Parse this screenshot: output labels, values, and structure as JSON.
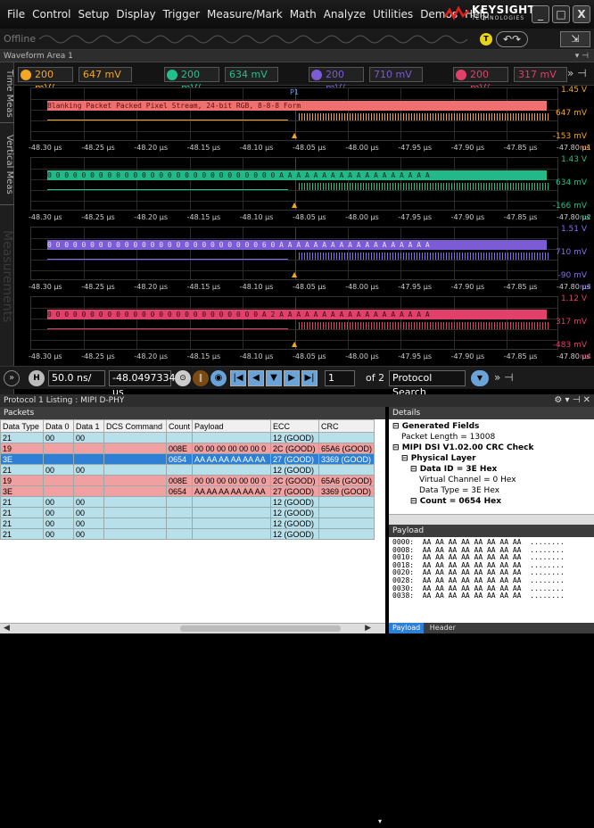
{
  "menu": [
    "File",
    "Control",
    "Setup",
    "Display",
    "Trigger",
    "Measure/Mark",
    "Math",
    "Analyze",
    "Utilities",
    "Demos",
    "Help"
  ],
  "brand": {
    "name": "KEYSIGHT",
    "sub": "TECHNOLOGIES"
  },
  "window_buttons": {
    "minimize": "_",
    "maximize": "□",
    "close": "X"
  },
  "status": {
    "offline": "Offline"
  },
  "waveform_area": {
    "title": "Waveform Area 1"
  },
  "side_tabs": [
    "Time Meas",
    "Vertical Meas",
    "Measurements"
  ],
  "channel_chips": [
    {
      "id": "m3",
      "label": "200 mV/",
      "offset": "647 mV",
      "color": "#f5a623"
    },
    {
      "id": "m2",
      "label": "200 mV/",
      "offset": "634 mV",
      "color": "#22c08a"
    },
    {
      "id": "m3b",
      "label": "200 mV/",
      "offset": "710 mV",
      "color": "#7b5bd6"
    },
    {
      "id": "m4",
      "label": "200 mV/",
      "offset": "317 mV",
      "color": "#e0406a"
    }
  ],
  "panels": [
    {
      "top": "1.45 V",
      "mid": "647 mV",
      "bot": "-153 mV",
      "ch": "m1",
      "bus_color": "#f07070",
      "bus_text": "Blanking Packet                         Packed Pixel Stream, 24-bit RGB, 8-8-8 Form",
      "sig_color": "#f5a623",
      "marker": "P1"
    },
    {
      "top": "1.43 V",
      "mid": "634 mV",
      "bot": "-166 mV",
      "ch": "m2",
      "bus_color": "#22b888",
      "bus_text": "0 0 0 0 0 0 0 0 0 0 0 0 0 0 0 0 0 0 0 0 0 0 0 0 0 0 0 A A A A A A A A A A A A A A A A A A",
      "sig_color": "#22c08a",
      "marker": ""
    },
    {
      "top": "1.51 V",
      "mid": "710 mV",
      "bot": "-90 mV",
      "ch": "m3",
      "bus_color": "#7b5bd6",
      "bus_text": "0 0 0 0 0 0 0 0 0 0 0 0 0 0 0 0 0 0 0 0 0 0 0 0 0 6 0 A A A A A A A A A A A A A A A A A A",
      "sig_color": "#8a6cf0",
      "marker": ""
    },
    {
      "top": "1.12 V",
      "mid": "317 mV",
      "bot": "-483 mV",
      "ch": "m4",
      "bus_color": "#e0406a",
      "bus_text": "0 0 0 0 0 0 0 0 0 0 0 0 0 0 0 0 0 0 0 0 0 0 0 0 0 A 2 A A A A A A A A A A A A A A A A A A",
      "sig_color": "#e0406a",
      "marker": ""
    }
  ],
  "axis_ticks": [
    "-48.30 µs",
    "-48.25 µs",
    "-48.20 µs",
    "-48.15 µs",
    "-48.10 µs",
    "-48.05 µs",
    "-48.00 µs",
    "-47.95 µs",
    "-47.90 µs",
    "-47.85 µs",
    "-47.80 µs"
  ],
  "controls": {
    "timebase": "50.0 ns/",
    "position": "-48.0497334 µs",
    "page": "1",
    "page_of": "of 2",
    "search": "Protocol Search"
  },
  "protocol": {
    "title": "Protocol 1 Listing : MIPI D-PHY",
    "packets_label": "Packets"
  },
  "table": {
    "columns": [
      "Data Type",
      "Data 0",
      "Data 1",
      "DCS Command",
      "Count",
      "Payload",
      "ECC",
      "CRC"
    ],
    "rows": [
      {
        "style": "a",
        "cells": [
          "21",
          "00",
          "00",
          "",
          "",
          "",
          "12 (GOOD)",
          ""
        ]
      },
      {
        "style": "b",
        "cells": [
          "19",
          "",
          "",
          "",
          "008E",
          "00 00 00 00 00 00 0",
          "2C (GOOD)",
          "65A6 (GOOD)"
        ]
      },
      {
        "style": "c",
        "cells": [
          "3E",
          "",
          "",
          "",
          "0654",
          "AA AA AA AA AA AA",
          "27 (GOOD)",
          "3369 (GOOD)"
        ]
      },
      {
        "style": "a",
        "cells": [
          "21",
          "00",
          "00",
          "",
          "",
          "",
          "12 (GOOD)",
          ""
        ]
      },
      {
        "style": "b",
        "cells": [
          "19",
          "",
          "",
          "",
          "008E",
          "00 00 00 00 00 00 0",
          "2C (GOOD)",
          "65A6 (GOOD)"
        ]
      },
      {
        "style": "b",
        "cells": [
          "3E",
          "",
          "",
          "",
          "0654",
          "AA AA AA AA AA AA",
          "27 (GOOD)",
          "3369 (GOOD)"
        ]
      },
      {
        "style": "a",
        "cells": [
          "21",
          "00",
          "00",
          "",
          "",
          "",
          "12 (GOOD)",
          ""
        ]
      },
      {
        "style": "a",
        "cells": [
          "21",
          "00",
          "00",
          "",
          "",
          "",
          "12 (GOOD)",
          ""
        ]
      },
      {
        "style": "a",
        "cells": [
          "21",
          "00",
          "00",
          "",
          "",
          "",
          "12 (GOOD)",
          ""
        ]
      },
      {
        "style": "a",
        "cells": [
          "21",
          "00",
          "00",
          "",
          "",
          "",
          "12 (GOOD)",
          ""
        ]
      }
    ]
  },
  "details": {
    "title": "Details",
    "tree": [
      {
        "lvl": 0,
        "text": "Generated Fields",
        "bold": true
      },
      {
        "lvl": 1,
        "text": "Packet Length = 13008",
        "bold": false
      },
      {
        "lvl": 0,
        "text": "MIPI DSI V1.02.00 CRC Check",
        "bold": true
      },
      {
        "lvl": 1,
        "text": "Physical Layer",
        "bold": true
      },
      {
        "lvl": 2,
        "text": "Data ID = 3E Hex",
        "bold": true
      },
      {
        "lvl": 3,
        "text": "Virtual Channel = 0 Hex",
        "bold": false
      },
      {
        "lvl": 3,
        "text": "Data Type = 3E Hex",
        "bold": false
      },
      {
        "lvl": 2,
        "text": "Count = 0654 Hex",
        "bold": true
      }
    ]
  },
  "payload": {
    "title": "Payload",
    "lines": [
      "0000:  AA AA AA AA AA AA AA AA  ........",
      "0008:  AA AA AA AA AA AA AA AA  ........",
      "0010:  AA AA AA AA AA AA AA AA  ........",
      "0018:  AA AA AA AA AA AA AA AA  ........",
      "0020:  AA AA AA AA AA AA AA AA  ........",
      "0028:  AA AA AA AA AA AA AA AA  ........",
      "0030:  AA AA AA AA AA AA AA AA  ........",
      "0038:  AA AA AA AA AA AA AA AA  ........"
    ],
    "tabs": [
      "Payload",
      "Header"
    ]
  }
}
